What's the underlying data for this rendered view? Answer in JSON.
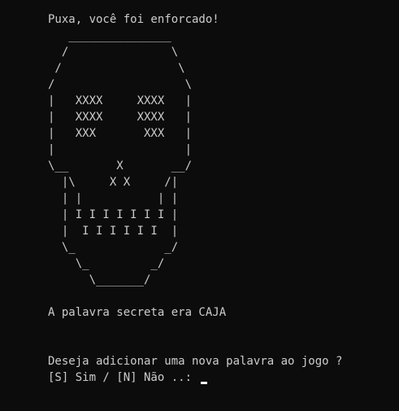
{
  "console": {
    "header": "Puxa, você foi enforcado!",
    "skull": "   _______________\n  /               \\\n /                 \\\n/                   \\\n|   XXXX     XXXX   |\n|   XXXX     XXXX   |\n|   XXX       XXX   |\n|                   |\n\\__       X       __/\n  |\\     X X     /|\n  | |           | |\n  | I I I I I I I |\n  |  I I I I I I  |\n  \\_             _/\n    \\_         _/\n      \\_______/",
    "secret_word_message": "A palavra secreta era CAJA",
    "question": "Deseja adicionar uma nova palavra ao jogo ?",
    "prompt": "[S] Sim / [N] Não ..: "
  }
}
